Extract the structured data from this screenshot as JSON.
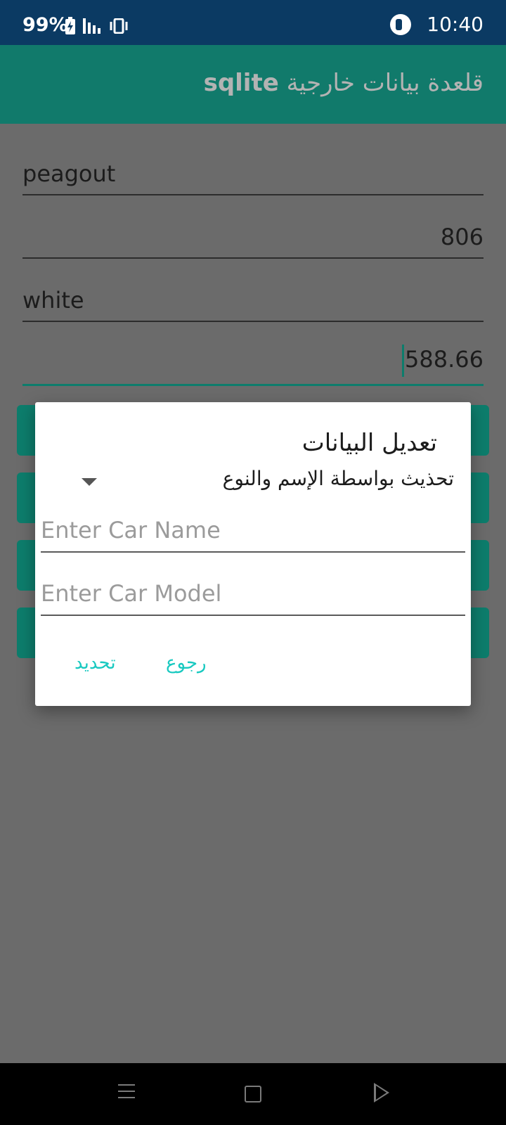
{
  "status_bar": {
    "battery": "99%",
    "time": "10:40",
    "icons": [
      "battery-charging-icon",
      "signal-bars-icon",
      "vibrate-icon",
      "app-indicator-icon"
    ]
  },
  "app_bar": {
    "title_arabic": "قلعدة بيانات خارجية",
    "title_latin": "sqlite"
  },
  "form": {
    "name_value": "peagout",
    "model_value": "806",
    "color_value": "white",
    "price_value": "588.66"
  },
  "dialog": {
    "title": "تعديل البيانات",
    "selected_option": "تحذيث بواسطة الإسم والنوع",
    "car_name_placeholder": "Enter Car Name",
    "car_model_placeholder": "Enter Car Model",
    "update_label": "تحديد",
    "back_label": "رجوع"
  },
  "colors": {
    "status_bar": "#0b3a63",
    "accent": "#0d7d6c",
    "dialog_button_text": "#18c9c0",
    "scrim": "#6b6b6b"
  }
}
